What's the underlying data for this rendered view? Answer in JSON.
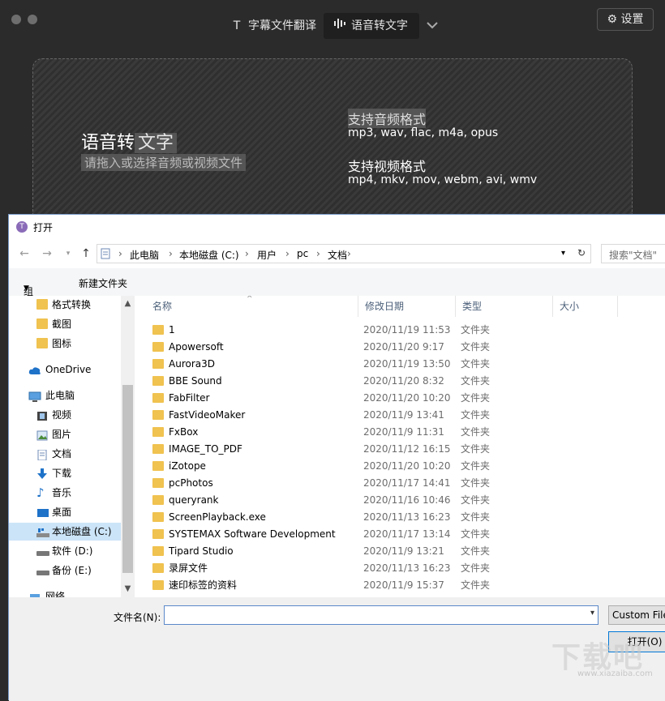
{
  "app": {
    "tabs": [
      {
        "label": "字幕文件翻译",
        "icon": "text-icon"
      },
      {
        "label": "语音转文字",
        "icon": "waveform-icon",
        "active": true
      }
    ],
    "settings_label": "设置"
  },
  "dropzone": {
    "title_a": "语音转",
    "title_b": "文字",
    "subtitle": "请拖入或选择音频或视频文件",
    "audio_heading": "支持音频格式",
    "audio_formats": "mp3, wav, flac, m4a, opus",
    "video_heading": "支持视频格式",
    "video_formats": "mp4, mkv, mov, webm, avi, wmv"
  },
  "dialog": {
    "title": "打开",
    "breadcrumb": [
      "此电脑",
      "本地磁盘 (C:)",
      "用户",
      "pc",
      "文档"
    ],
    "search_placeholder": "搜索\"文档\"",
    "toolbar": {
      "organize": "组织",
      "new_folder": "新建文件夹"
    },
    "sidebar": [
      {
        "label": "格式转换",
        "icon": "folder-icon"
      },
      {
        "label": "截图",
        "icon": "folder-icon"
      },
      {
        "label": "图标",
        "icon": "folder-icon"
      },
      {
        "label": "OneDrive",
        "icon": "cloud-icon"
      },
      {
        "label": "此电脑",
        "icon": "computer-icon"
      },
      {
        "label": "视频",
        "icon": "video-icon"
      },
      {
        "label": "图片",
        "icon": "pictures-icon"
      },
      {
        "label": "文档",
        "icon": "documents-icon"
      },
      {
        "label": "下载",
        "icon": "download-icon"
      },
      {
        "label": "音乐",
        "icon": "music-icon"
      },
      {
        "label": "桌面",
        "icon": "desktop-icon"
      },
      {
        "label": "本地磁盘 (C:)",
        "icon": "drive-icon",
        "selected": true
      },
      {
        "label": "软件 (D:)",
        "icon": "drive-icon"
      },
      {
        "label": "备份 (E:)",
        "icon": "drive-icon"
      },
      {
        "label": "网络",
        "icon": "network-icon"
      }
    ],
    "columns": {
      "name": "名称",
      "date": "修改日期",
      "type": "类型",
      "size": "大小"
    },
    "files": [
      {
        "name": "1",
        "date": "2020/11/19 11:53",
        "type": "文件夹"
      },
      {
        "name": "Apowersoft",
        "date": "2020/11/20 9:17",
        "type": "文件夹"
      },
      {
        "name": "Aurora3D",
        "date": "2020/11/19 13:50",
        "type": "文件夹"
      },
      {
        "name": "BBE Sound",
        "date": "2020/11/20 8:32",
        "type": "文件夹"
      },
      {
        "name": "FabFilter",
        "date": "2020/11/20 10:20",
        "type": "文件夹"
      },
      {
        "name": "FastVideoMaker",
        "date": "2020/11/9 13:41",
        "type": "文件夹"
      },
      {
        "name": "FxBox",
        "date": "2020/11/9 11:31",
        "type": "文件夹"
      },
      {
        "name": "IMAGE_TO_PDF",
        "date": "2020/11/12 16:15",
        "type": "文件夹"
      },
      {
        "name": "iZotope",
        "date": "2020/11/20 10:20",
        "type": "文件夹"
      },
      {
        "name": "pcPhotos",
        "date": "2020/11/17 14:41",
        "type": "文件夹"
      },
      {
        "name": "queryrank",
        "date": "2020/11/16 10:46",
        "type": "文件夹"
      },
      {
        "name": "ScreenPlayback.exe",
        "date": "2020/11/13 16:23",
        "type": "文件夹"
      },
      {
        "name": "SYSTEMAX Software Development",
        "date": "2020/11/17 13:14",
        "type": "文件夹"
      },
      {
        "name": "Tipard Studio",
        "date": "2020/11/9 13:21",
        "type": "文件夹"
      },
      {
        "name": "录屏文件",
        "date": "2020/11/13 16:23",
        "type": "文件夹"
      },
      {
        "name": "速印标签的资料",
        "date": "2020/11/9 15:37",
        "type": "文件夹"
      }
    ],
    "filename_label": "文件名(N):",
    "filename_value": "",
    "filetype_value": "Custom Files",
    "open_label": "打开(O)"
  },
  "watermark": {
    "main": "下载吧",
    "url": "www.xiazaiba.com"
  },
  "colors": {
    "folder": "#f0c24f",
    "selection": "#cce4f7",
    "accent": "#0078d7"
  }
}
